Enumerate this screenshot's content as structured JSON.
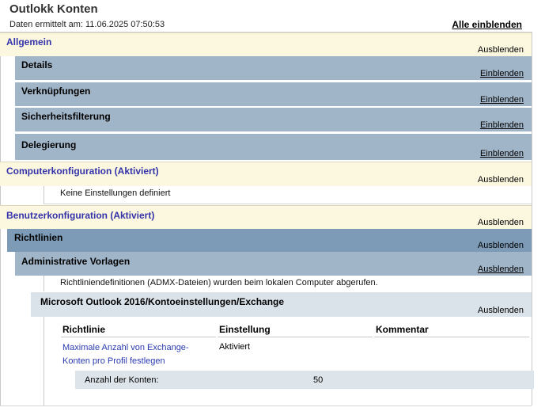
{
  "header": {
    "title": "Outlokk Konten",
    "data_time": "Daten ermittelt am: 11.06.2025 07:50:53",
    "show_all": "Alle einblenden"
  },
  "sections": {
    "general": {
      "title": "Allgemein",
      "toggle": "Ausblenden"
    },
    "details": {
      "title": "Details",
      "toggle": "Einblenden"
    },
    "links": {
      "title": "Verknüpfungen",
      "toggle": "Einblenden"
    },
    "security": {
      "title": "Sicherheitsfilterung",
      "toggle": "Einblenden"
    },
    "delegation": {
      "title": "Delegierung",
      "toggle": "Einblenden"
    },
    "computer": {
      "title": "Computerkonfiguration (Aktiviert)",
      "toggle": "Ausblenden",
      "note": "Keine Einstellungen definiert"
    },
    "user": {
      "title": "Benutzerkonfiguration (Aktiviert)",
      "toggle": "Ausblenden"
    },
    "policies": {
      "title": "Richtlinien",
      "toggle": "Ausblenden"
    },
    "admin_templates": {
      "title": "Administrative Vorlagen",
      "toggle": "Ausblenden",
      "note": "Richtliniendefinitionen (ADMX-Dateien) wurden beim lokalen Computer abgerufen."
    },
    "exchange": {
      "title": "Microsoft Outlook 2016/Kontoeinstellungen/Exchange",
      "toggle": "Ausblenden"
    }
  },
  "policy_table": {
    "columns": [
      "Richtlinie",
      "Einstellung",
      "Kommentar"
    ],
    "row": {
      "policy": "Maximale Anzahl von Exchange-Konten pro Profil festlegen",
      "setting": "Aktiviert",
      "comment": ""
    },
    "sub": {
      "key": "Anzahl der Konten:",
      "value": "50"
    }
  }
}
